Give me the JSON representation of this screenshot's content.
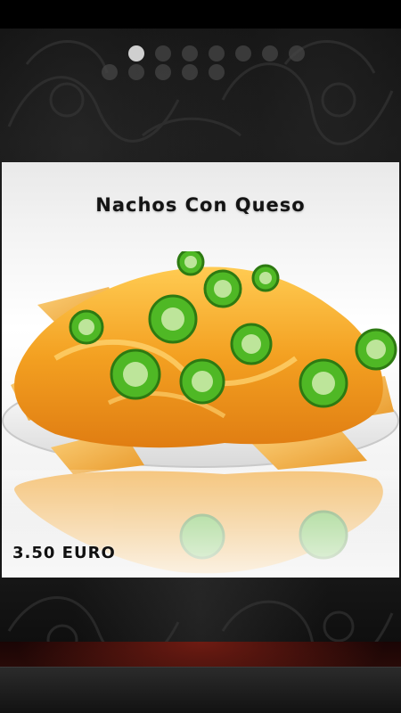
{
  "pager": {
    "dot_count": 7,
    "active_index": 0
  },
  "card": {
    "title": "Nachos Con Queso",
    "price": "3.50 EURO",
    "image": "nachos-with-cheese-and-jalapenos-photo"
  },
  "colors": {
    "background": "#0b0b0b",
    "card": "#f4f4f4",
    "cheese": "#f3a021",
    "jalapeno": "#3fa31b",
    "bottom_accent": "#5c140d"
  }
}
